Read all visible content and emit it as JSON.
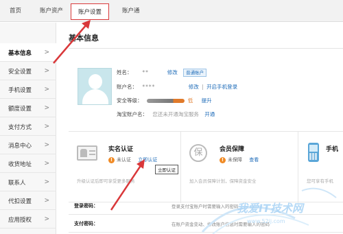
{
  "topnav": {
    "tabs": [
      {
        "label": "首页"
      },
      {
        "label": "账户资产"
      },
      {
        "label": "账户设置"
      },
      {
        "label": "账户通"
      }
    ]
  },
  "sidebar": {
    "items": [
      {
        "label": "基本信息",
        "active": true
      },
      {
        "label": "安全设置"
      },
      {
        "label": "手机设置"
      },
      {
        "label": "额度设置"
      },
      {
        "label": "支付方式"
      },
      {
        "label": "消息中心"
      },
      {
        "label": "收货地址"
      },
      {
        "label": "联系人"
      },
      {
        "label": "代扣设置"
      },
      {
        "label": "应用授权"
      }
    ],
    "chevron": ">"
  },
  "main": {
    "title": "基本信息",
    "profile": {
      "name_label": "姓名：",
      "name_value": "**",
      "name_edit": "修改",
      "name_badge": "普通账户",
      "account_label": "账户名：",
      "account_value": "****",
      "account_edit": "修改",
      "account_sep": "|",
      "account_mobile_login": "开启手机登录",
      "security_label": "安全等级：",
      "security_value": "低",
      "security_upgrade": "提升",
      "taobao_label": "淘宝账户名：",
      "taobao_value": "您还未开通淘宝服务",
      "taobao_open": "开通"
    },
    "cards": [
      {
        "title": "实名认证",
        "status": "未认证",
        "action": "立即认证",
        "desc": "升级认证后即可享受更多服务",
        "tooltip": "立即认证"
      },
      {
        "title": "会员保障",
        "status": "未保障",
        "action": "查看",
        "desc": "加入会员保障计划，保障资金安全",
        "icon_glyph": "保"
      },
      {
        "title": "手机",
        "desc": "您可享有手机"
      }
    ],
    "settings": [
      {
        "label": "登录密码：",
        "desc": "登录支付宝账户时需要输入的密码"
      },
      {
        "label": "支付密码：",
        "desc": "在账户资金变动、修改账户信息时需要输入的密码"
      }
    ]
  },
  "watermark": {
    "text": "我爱IT技术网",
    "url": "www.52ij.com"
  },
  "colors": {
    "accent_red": "#d9383a",
    "link_blue": "#1d6bb8",
    "warn_orange": "#f08a24"
  }
}
